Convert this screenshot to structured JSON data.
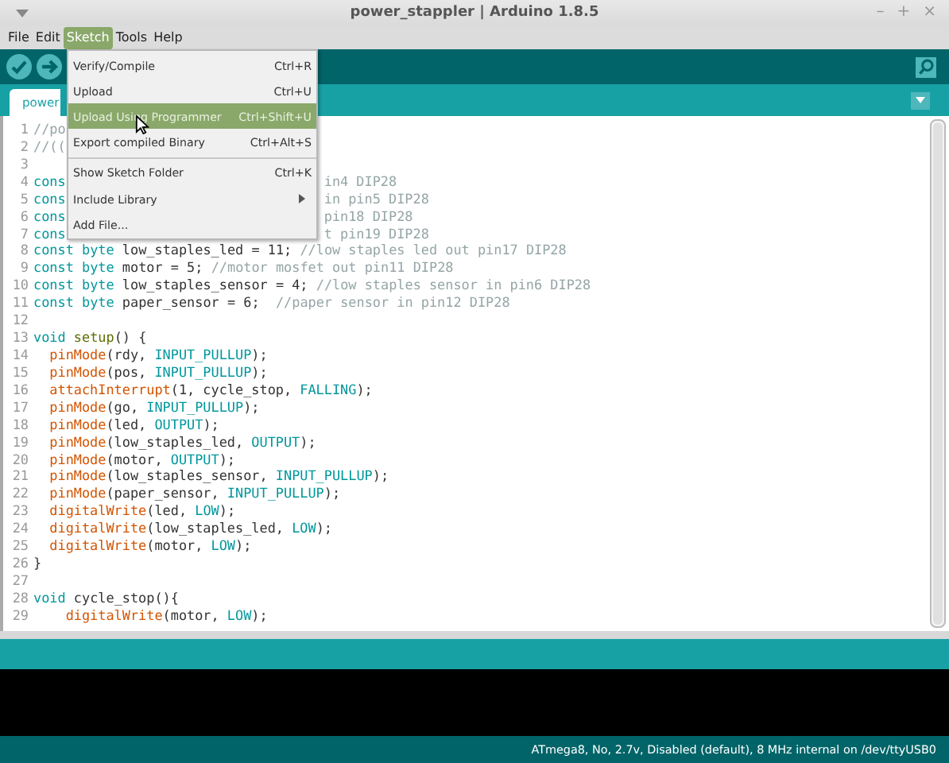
{
  "window": {
    "title": "power_stappler | Arduino 1.8.5",
    "controls": [
      "–",
      "+",
      "×"
    ]
  },
  "menubar": [
    {
      "label": "File",
      "selected": false
    },
    {
      "label": "Edit",
      "selected": false
    },
    {
      "label": "Sketch",
      "selected": true
    },
    {
      "label": "Tools",
      "selected": false
    },
    {
      "label": "Help",
      "selected": false
    }
  ],
  "menu": [
    {
      "label": "Verify/Compile",
      "shortcut": "Ctrl+R",
      "selected": false,
      "divider_above": false,
      "submenu": false
    },
    {
      "label": "Upload",
      "shortcut": "Ctrl+U",
      "selected": false,
      "divider_above": false,
      "submenu": false
    },
    {
      "label": "Upload Using Programmer",
      "shortcut": "Ctrl+Shift+U",
      "selected": true,
      "divider_above": false,
      "submenu": false
    },
    {
      "label": "Export compiled Binary",
      "shortcut": "Ctrl+Alt+S",
      "selected": false,
      "divider_above": false,
      "submenu": false
    },
    {
      "label": "Show Sketch Folder",
      "shortcut": "Ctrl+K",
      "selected": false,
      "divider_above": true,
      "submenu": false
    },
    {
      "label": "Include Library",
      "selected": false,
      "divider_above": false,
      "submenu": true
    },
    {
      "label": "Add File...",
      "selected": false,
      "divider_above": false,
      "submenu": false
    }
  ],
  "tab": {
    "label": "power"
  },
  "editor": {
    "lines": [
      {
        "number": "1",
        "tokens": [
          {
            "kind": "comment",
            "text": "//po"
          }
        ]
      },
      {
        "number": "2",
        "tokens": [
          {
            "kind": "comment",
            "text": "//(("
          }
        ]
      },
      {
        "number": "3"
      },
      {
        "number": "4",
        "tokens": [
          {
            "kind": "keyword",
            "text": "cons"
          }
        ],
        "after_menu": [
          {
            "kind": "comment",
            "text": "in4 DIP28"
          }
        ]
      },
      {
        "number": "5",
        "tokens": [
          {
            "kind": "keyword",
            "text": "cons"
          }
        ],
        "after_menu": [
          {
            "kind": "comment",
            "text": "in pin5 DIP28"
          }
        ]
      },
      {
        "number": "6",
        "tokens": [
          {
            "kind": "keyword",
            "text": "cons"
          }
        ],
        "after_menu": [
          {
            "kind": "comment",
            "text": "pin18 DIP28"
          }
        ]
      },
      {
        "number": "7",
        "tokens": [
          {
            "kind": "keyword",
            "text": "cons"
          }
        ],
        "after_menu": [
          {
            "kind": "comment",
            "text": "t pin19 DIP28"
          }
        ]
      },
      {
        "number": "8",
        "tokens": [
          {
            "kind": "keyword",
            "text": "const"
          },
          {
            "kind": "keyword",
            "text": "byte"
          },
          {
            "kind": "plain",
            "text": "low_staples_led = 11;"
          },
          {
            "kind": "comment",
            "text": "//low staples led out pin17 DIP28"
          }
        ]
      },
      {
        "number": "9",
        "tokens": [
          {
            "kind": "keyword",
            "text": "const"
          },
          {
            "kind": "keyword",
            "text": "byte"
          },
          {
            "kind": "plain",
            "text": "motor = 5;"
          },
          {
            "kind": "comment",
            "text": "//motor mosfet out pin11 DIP28"
          }
        ]
      },
      {
        "number": "10",
        "tokens": [
          {
            "kind": "keyword",
            "text": "const"
          },
          {
            "kind": "keyword",
            "text": "byte"
          },
          {
            "kind": "plain",
            "text": "low_staples_sensor = 4;"
          },
          {
            "kind": "comment",
            "text": "//low staples sensor in pin6 DIP28"
          }
        ]
      },
      {
        "number": "11",
        "tokens": [
          {
            "kind": "keyword",
            "text": "const"
          },
          {
            "kind": "keyword",
            "text": "byte"
          },
          {
            "kind": "plain",
            "text": "paper_sensor = 6; "
          },
          {
            "kind": "comment",
            "text": "//paper sensor in pin12 DIP28"
          }
        ]
      },
      {
        "number": "12"
      },
      {
        "number": "13",
        "tokens": [
          {
            "kind": "keyword",
            "text": "void"
          },
          {
            "kind": "structure",
            "text": "setup"
          },
          {
            "kind": "plain",
            "text": "() {"
          }
        ]
      },
      {
        "number": "14",
        "tokens": [
          {
            "kind": "function",
            "text": "  pinMode"
          },
          {
            "kind": "plain",
            "text": "(rdy, "
          },
          {
            "kind": "constant",
            "text": "INPUT_PULLUP"
          },
          {
            "kind": "plain",
            "text": ");"
          }
        ]
      },
      {
        "number": "15",
        "tokens": [
          {
            "kind": "function",
            "text": "  pinMode"
          },
          {
            "kind": "plain",
            "text": "(pos, "
          },
          {
            "kind": "constant",
            "text": "INPUT_PULLUP"
          },
          {
            "kind": "plain",
            "text": ");"
          }
        ]
      },
      {
        "number": "16",
        "tokens": [
          {
            "kind": "function",
            "text": "  attachInterrupt"
          },
          {
            "kind": "plain",
            "text": "(1, cycle_stop, "
          },
          {
            "kind": "constant",
            "text": "FALLING"
          },
          {
            "kind": "plain",
            "text": ");"
          }
        ]
      },
      {
        "number": "17",
        "tokens": [
          {
            "kind": "function",
            "text": "  pinMode"
          },
          {
            "kind": "plain",
            "text": "(go, "
          },
          {
            "kind": "constant",
            "text": "INPUT_PULLUP"
          },
          {
            "kind": "plain",
            "text": ");"
          }
        ]
      },
      {
        "number": "18",
        "tokens": [
          {
            "kind": "function",
            "text": "  pinMode"
          },
          {
            "kind": "plain",
            "text": "(led, "
          },
          {
            "kind": "constant",
            "text": "OUTPUT"
          },
          {
            "kind": "plain",
            "text": ");"
          }
        ]
      },
      {
        "number": "19",
        "tokens": [
          {
            "kind": "function",
            "text": "  pinMode"
          },
          {
            "kind": "plain",
            "text": "(low_staples_led, "
          },
          {
            "kind": "constant",
            "text": "OUTPUT"
          },
          {
            "kind": "plain",
            "text": ");"
          }
        ]
      },
      {
        "number": "20",
        "tokens": [
          {
            "kind": "function",
            "text": "  pinMode"
          },
          {
            "kind": "plain",
            "text": "(motor, "
          },
          {
            "kind": "constant",
            "text": "OUTPUT"
          },
          {
            "kind": "plain",
            "text": ");"
          }
        ]
      },
      {
        "number": "21",
        "tokens": [
          {
            "kind": "function",
            "text": "  pinMode"
          },
          {
            "kind": "plain",
            "text": "(low_staples_sensor, "
          },
          {
            "kind": "constant",
            "text": "INPUT_PULLUP"
          },
          {
            "kind": "plain",
            "text": ");"
          }
        ]
      },
      {
        "number": "22",
        "tokens": [
          {
            "kind": "function",
            "text": "  pinMode"
          },
          {
            "kind": "plain",
            "text": "(paper_sensor, "
          },
          {
            "kind": "constant",
            "text": "INPUT_PULLUP"
          },
          {
            "kind": "plain",
            "text": ");"
          }
        ]
      },
      {
        "number": "23",
        "tokens": [
          {
            "kind": "function",
            "text": "  digitalWrite"
          },
          {
            "kind": "plain",
            "text": "(led, "
          },
          {
            "kind": "constant",
            "text": "LOW"
          },
          {
            "kind": "plain",
            "text": ");"
          }
        ]
      },
      {
        "number": "24",
        "tokens": [
          {
            "kind": "function",
            "text": "  digitalWrite"
          },
          {
            "kind": "plain",
            "text": "(low_staples_led, "
          },
          {
            "kind": "constant",
            "text": "LOW"
          },
          {
            "kind": "plain",
            "text": ");"
          }
        ]
      },
      {
        "number": "25",
        "tokens": [
          {
            "kind": "function",
            "text": "  digitalWrite"
          },
          {
            "kind": "plain",
            "text": "(motor, "
          },
          {
            "kind": "constant",
            "text": "LOW"
          },
          {
            "kind": "plain",
            "text": ");"
          }
        ]
      },
      {
        "number": "26",
        "tokens": [
          {
            "kind": "plain",
            "text": "}"
          }
        ]
      },
      {
        "number": "27"
      },
      {
        "number": "28",
        "tokens": [
          {
            "kind": "keyword",
            "text": "void"
          },
          {
            "kind": "plain",
            "text": "cycle_stop(){"
          }
        ]
      },
      {
        "number": "29",
        "tokens": [
          {
            "kind": "function",
            "text": "    digitalWrite"
          },
          {
            "kind": "plain",
            "text": "(motor, "
          },
          {
            "kind": "constant",
            "text": "LOW"
          },
          {
            "kind": "plain",
            "text": ");"
          }
        ]
      }
    ]
  },
  "status_bar": {
    "text": "ATmega8, No, 2.7v, Disabled (default), 8 MHz internal on /dev/ttyUSB0"
  }
}
